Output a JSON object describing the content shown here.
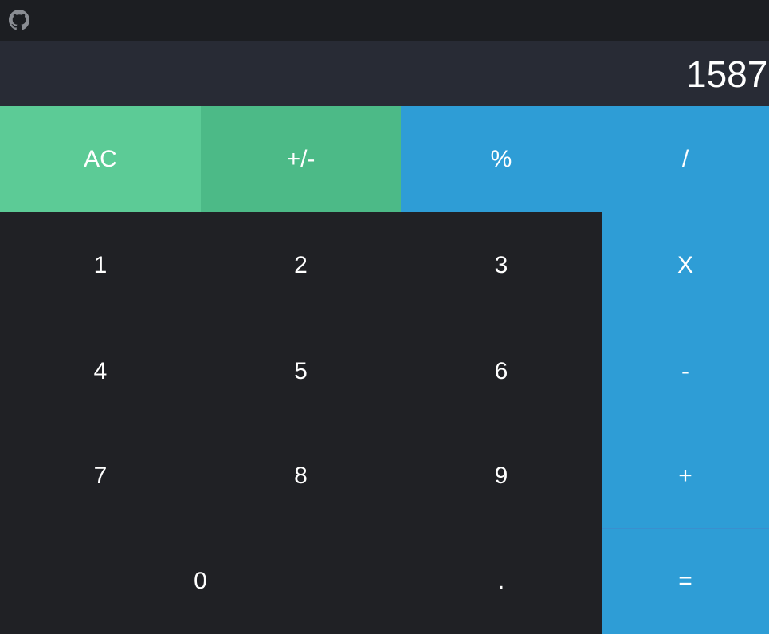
{
  "header": {
    "github_icon": "github-icon"
  },
  "display": {
    "value": "1587"
  },
  "keys": {
    "ac": "AC",
    "sign": "+/-",
    "percent": "%",
    "divide": "/",
    "one": "1",
    "two": "2",
    "three": "3",
    "multiply": "X",
    "four": "4",
    "five": "5",
    "six": "6",
    "minus": "-",
    "seven": "7",
    "eight": "8",
    "nine": "9",
    "plus": "+",
    "zero": "0",
    "dot": ".",
    "equals": "="
  },
  "colors": {
    "ac": "#5ccb96",
    "sign": "#4cba87",
    "operator": "#2e9dd6",
    "number": "#202125",
    "display_bg": "#282b35",
    "topbar_bg": "#1c1e22"
  }
}
